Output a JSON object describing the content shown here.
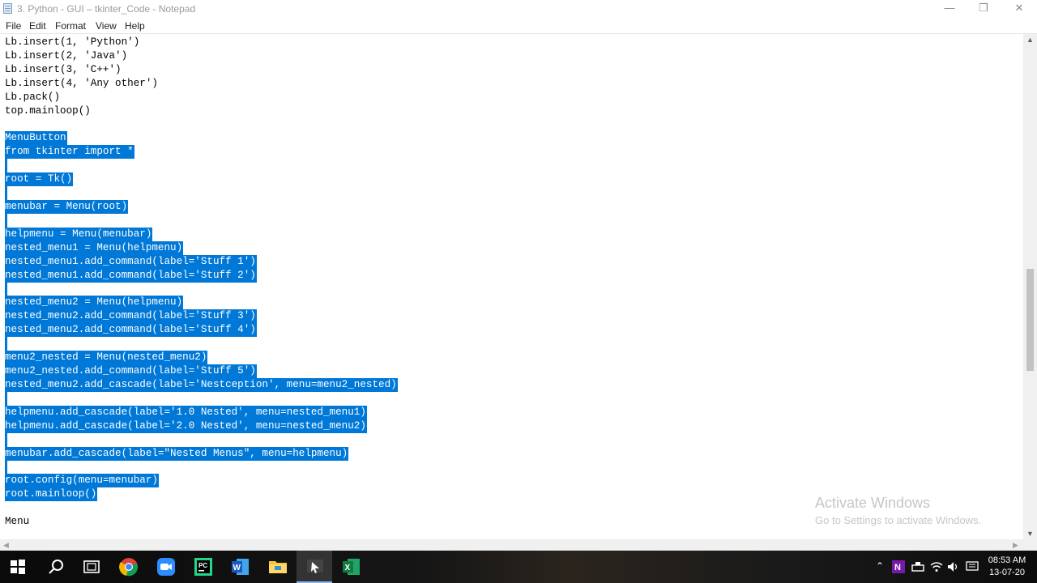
{
  "window": {
    "title": "3. Python - GUI – tkinter_Code - Notepad"
  },
  "menu": [
    "File",
    "Edit",
    "Format",
    "View",
    "Help"
  ],
  "editor": {
    "lines": [
      {
        "text": "Lb.insert(1, 'Python')",
        "sel": false
      },
      {
        "text": "Lb.insert(2, 'Java')",
        "sel": false
      },
      {
        "text": "Lb.insert(3, 'C++')",
        "sel": false
      },
      {
        "text": "Lb.insert(4, 'Any other')",
        "sel": false
      },
      {
        "text": "Lb.pack()",
        "sel": false
      },
      {
        "text": "top.mainloop()",
        "sel": false
      },
      {
        "text": "",
        "sel": false
      },
      {
        "text": "MenuButton",
        "sel": true
      },
      {
        "text": "from tkinter import *",
        "sel": true
      },
      {
        "text": "",
        "sel": true
      },
      {
        "text": "root = Tk()",
        "sel": true
      },
      {
        "text": "",
        "sel": true
      },
      {
        "text": "menubar = Menu(root)",
        "sel": true
      },
      {
        "text": "",
        "sel": true
      },
      {
        "text": "helpmenu = Menu(menubar)",
        "sel": true
      },
      {
        "text": "nested_menu1 = Menu(helpmenu)",
        "sel": true
      },
      {
        "text": "nested_menu1.add_command(label='Stuff 1')",
        "sel": true
      },
      {
        "text": "nested_menu1.add_command(label='Stuff 2')",
        "sel": true
      },
      {
        "text": "",
        "sel": true
      },
      {
        "text": "nested_menu2 = Menu(helpmenu)",
        "sel": true
      },
      {
        "text": "nested_menu2.add_command(label='Stuff 3')",
        "sel": true
      },
      {
        "text": "nested_menu2.add_command(label='Stuff 4')",
        "sel": true
      },
      {
        "text": "",
        "sel": true
      },
      {
        "text": "menu2_nested = Menu(nested_menu2)",
        "sel": true
      },
      {
        "text": "menu2_nested.add_command(label='Stuff 5')",
        "sel": true
      },
      {
        "text": "nested_menu2.add_cascade(label='Nestception', menu=menu2_nested)",
        "sel": true
      },
      {
        "text": "",
        "sel": true
      },
      {
        "text": "helpmenu.add_cascade(label='1.0 Nested', menu=nested_menu1)",
        "sel": true
      },
      {
        "text": "helpmenu.add_cascade(label='2.0 Nested', menu=nested_menu2)",
        "sel": true
      },
      {
        "text": "",
        "sel": true
      },
      {
        "text": "menubar.add_cascade(label=\"Nested Menus\", menu=helpmenu)",
        "sel": true
      },
      {
        "text": "",
        "sel": true
      },
      {
        "text": "root.config(menu=menubar)",
        "sel": true
      },
      {
        "text": "root.mainloop()",
        "sel": true
      },
      {
        "text": "",
        "sel": false
      },
      {
        "text": "Menu",
        "sel": false
      }
    ]
  },
  "watermark": {
    "line1": "Activate Windows",
    "line2": "Go to Settings to activate Windows."
  },
  "taskbar": {
    "apps": [
      "windows-start",
      "search",
      "task-view",
      "chrome",
      "zoom",
      "pycharm",
      "word",
      "file-explorer",
      "screen-recorder",
      "excel"
    ],
    "tray_icons": [
      "chevron-up",
      "onenote",
      "network-drive",
      "wifi",
      "volume",
      "chat"
    ],
    "time": "08:53 AM",
    "date": "13-07-20"
  },
  "colors": {
    "selection": "#0078d7",
    "editor_bg": "#ffffff"
  }
}
